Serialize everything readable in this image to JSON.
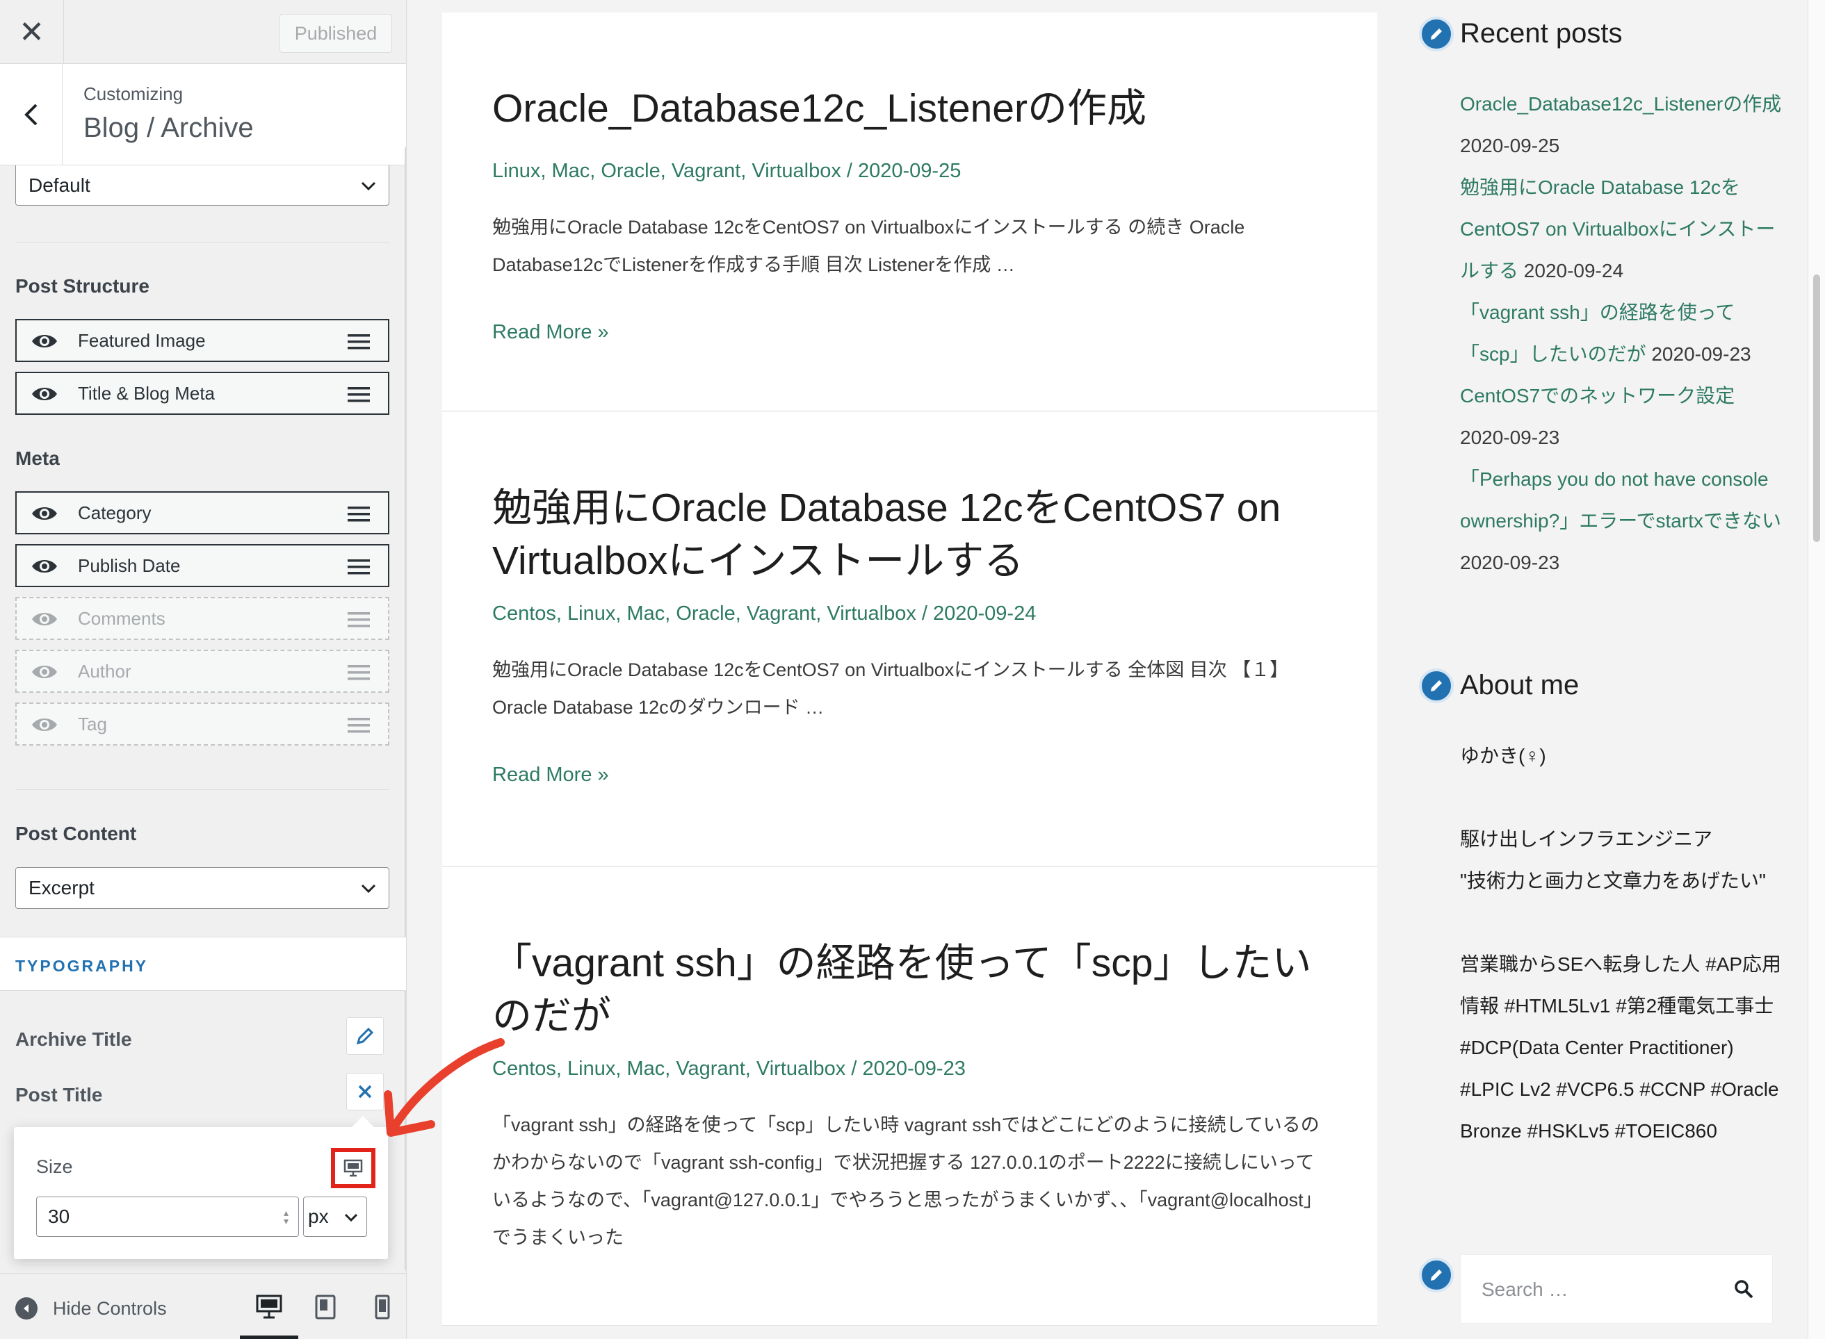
{
  "header": {
    "close_glyph": "✕",
    "published_label": "Published"
  },
  "section": {
    "customizing_label": "Customizing",
    "title": "Blog / Archive"
  },
  "layout_select": {
    "value": "Default"
  },
  "post_structure": {
    "label": "Post Structure",
    "items": [
      {
        "label": "Featured Image"
      },
      {
        "label": "Title & Blog Meta"
      }
    ]
  },
  "meta": {
    "label": "Meta",
    "items": [
      {
        "label": "Category",
        "enabled": true
      },
      {
        "label": "Publish Date",
        "enabled": true
      },
      {
        "label": "Comments",
        "enabled": false
      },
      {
        "label": "Author",
        "enabled": false
      },
      {
        "label": "Tag",
        "enabled": false
      }
    ]
  },
  "post_content": {
    "label": "Post Content",
    "value": "Excerpt"
  },
  "typography": {
    "label": "TYPOGRAPHY",
    "archive_title": "Archive Title",
    "post_title": "Post Title"
  },
  "size_popover": {
    "label": "Size",
    "value": "30",
    "unit": "px"
  },
  "footer": {
    "hide_controls": "Hide Controls"
  },
  "posts": [
    {
      "title": "Oracle_Database12c_Listenerの作成",
      "meta": "Linux, Mac, Oracle, Vagrant, Virtualbox / 2020-09-25",
      "excerpt": "勉強用にOracle Database 12cをCentOS7 on Virtualboxにインストールする の続き Oracle Database12cでListenerを作成する手順 目次 Listenerを作成 …",
      "read_more": "Read More »"
    },
    {
      "title": "勉強用にOracle Database 12cをCentOS7 on Virtualboxにインストールする",
      "meta": "Centos, Linux, Mac, Oracle, Vagrant, Virtualbox / 2020-09-24",
      "excerpt": "勉強用にOracle Database 12cをCentOS7 on Virtualboxにインストールする 全体図 目次 【１】Oracle Database 12cのダウンロード …",
      "read_more": "Read More »"
    },
    {
      "title": "「vagrant ssh」の経路を使って「scp」したいのだが",
      "meta": "Centos, Linux, Mac, Vagrant, Virtualbox / 2020-09-23",
      "excerpt": "「vagrant ssh」の経路を使って「scp」したい時 vagrant sshではどこにどのように接続しているのかわからないので「vagrant ssh-config」で状況把握する 127.0.0.1のポート2222に接続しにいっているようなので、「vagrant@127.0.0.1」でやろうと思ったがうまくいかず、、「vagrant@localhost」でうまくいった"
    }
  ],
  "sidebar": {
    "recent_posts": {
      "title": "Recent posts",
      "items": [
        {
          "link": "Oracle_Database12c_Listenerの作成",
          "date": "2020-09-25"
        },
        {
          "link": "勉強用にOracle Database 12cをCentOS7 on Virtualboxにインストールする",
          "date": "2020-09-24"
        },
        {
          "link": "「vagrant ssh」の経路を使って「scp」したいのだが",
          "date": "2020-09-23"
        },
        {
          "link": "CentOS7でのネットワーク設定",
          "date": "2020-09-23"
        },
        {
          "link": "「Perhaps you do not have console ownership?」エラーでstartxできない",
          "date": "2020-09-23"
        }
      ]
    },
    "about": {
      "title": "About me",
      "name": "ゆかき(♀)",
      "line1": "駆け出しインフラエンジニア",
      "line2": "\"技術力と画力と文章力をあげたい\"",
      "bio": "営業職からSEへ転身した人 #AP応用情報 #HTML5Lv1 #第2種電気工事士 #DCP(Data Center Practitioner) #LPIC Lv2 #VCP6.5 #CCNP #Oracle Bronze #HSKLv5 #TOEIC860"
    },
    "search": {
      "placeholder": "Search …"
    }
  },
  "colors": {
    "accent": "#2271b1",
    "link": "#2d7a63",
    "highlight": "#e2231a"
  }
}
